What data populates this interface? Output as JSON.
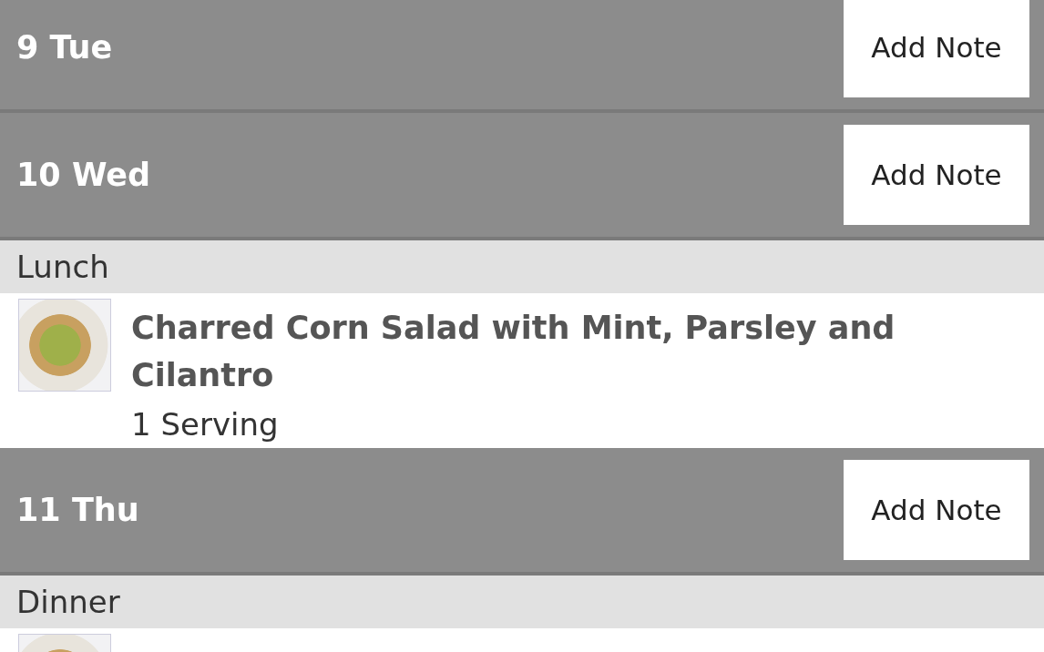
{
  "days": [
    {
      "date": "9 Tue",
      "button": "Add Note"
    },
    {
      "date": "10 Wed",
      "button": "Add Note",
      "meals": [
        {
          "meal": "Lunch",
          "recipes": [
            {
              "kind": "full",
              "title": "Charred Corn Salad with Mint, Parsley and Cilantro",
              "servings": "1 Serving"
            }
          ]
        }
      ]
    },
    {
      "date": "11 Thu",
      "button": "Add Note",
      "meals": [
        {
          "meal": "Dinner",
          "recipes": [
            {
              "kind": "cut"
            }
          ]
        }
      ]
    }
  ]
}
